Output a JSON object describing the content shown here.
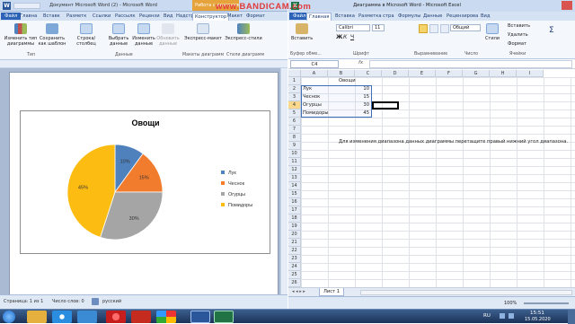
{
  "watermark": "www.BANDICAM.com",
  "word": {
    "title": "Документ Microsoft Word (2) - Microsoft Word",
    "context_tab": "Работа с диаграммами",
    "tabs": [
      "Файл",
      "Главна",
      "Вставк",
      "Разметк",
      "Ссылки",
      "Рассылк",
      "Рецензи",
      "Вид",
      "Надстр",
      "Конструктор",
      "Макет",
      "Формат"
    ],
    "ribbon_buttons": [
      "Изменить тип диаграммы",
      "Сохранить как шаблон",
      "Строка/столбец",
      "Выбрать данные",
      "Изменить данные",
      "Обновить данные",
      "Экспресс-макет",
      "Экспресс-стили"
    ],
    "ribbon_groups": [
      "Тип",
      "Данные",
      "Макеты диаграмм",
      "Стили диаграмм"
    ],
    "status": {
      "page": "Страница: 1 из 1",
      "words": "Число слов: 0",
      "lang": "русский"
    }
  },
  "chart_data": {
    "type": "pie",
    "title": "Овощи",
    "categories": [
      "Лук",
      "Чеснок",
      "Огурцы",
      "Помидоры"
    ],
    "values": [
      10,
      15,
      30,
      45
    ],
    "labels": [
      "10%",
      "15%",
      "30%",
      "45%"
    ],
    "colors": [
      "#4f81bd",
      "#f17c2d",
      "#a5a5a5",
      "#fdbc11"
    ],
    "legend": "right"
  },
  "excel": {
    "title": "Диаграмма в Microsoft Word - Microsoft Excel",
    "tabs": [
      "Файл",
      "Главная",
      "Вставка",
      "Разметка стра",
      "Формулы",
      "Данные",
      "Рецензирова",
      "Вид"
    ],
    "font": "Calibri",
    "font_size": "11",
    "number_format": "Общий",
    "ribbon_labels": {
      "paste": "Вставить",
      "insert": "Вставить",
      "delete": "Удалить",
      "format": "Формат",
      "styles": "Стили"
    },
    "ribbon_groups": [
      "Буфер обме...",
      "Шрифт",
      "Выравнивание",
      "Число",
      "Ячейки"
    ],
    "namebox": "C4",
    "fx": "fx",
    "columns": [
      "A",
      "B",
      "C",
      "D",
      "E",
      "F",
      "G",
      "H",
      "I"
    ],
    "rows": [
      "1",
      "2",
      "3",
      "4",
      "5",
      "6",
      "7",
      "8",
      "9",
      "10",
      "11",
      "12",
      "13",
      "14",
      "15",
      "16",
      "17",
      "18",
      "19",
      "20",
      "21",
      "22",
      "23",
      "24",
      "25",
      "26"
    ],
    "header_b1": "Овощи",
    "data": [
      [
        "Лук",
        "10"
      ],
      [
        "Чеснок",
        "15"
      ],
      [
        "Огурцы",
        "30"
      ],
      [
        "Помидоры",
        "45"
      ]
    ],
    "note": "Для изменения диапазона данных диаграммы перетащите правый нижний угол диапазона.",
    "sheet_tab": "Лист 1",
    "zoom": "100%"
  },
  "taskbar": {
    "lang": "RU",
    "time": "15:51",
    "date": "15.05.2020"
  }
}
